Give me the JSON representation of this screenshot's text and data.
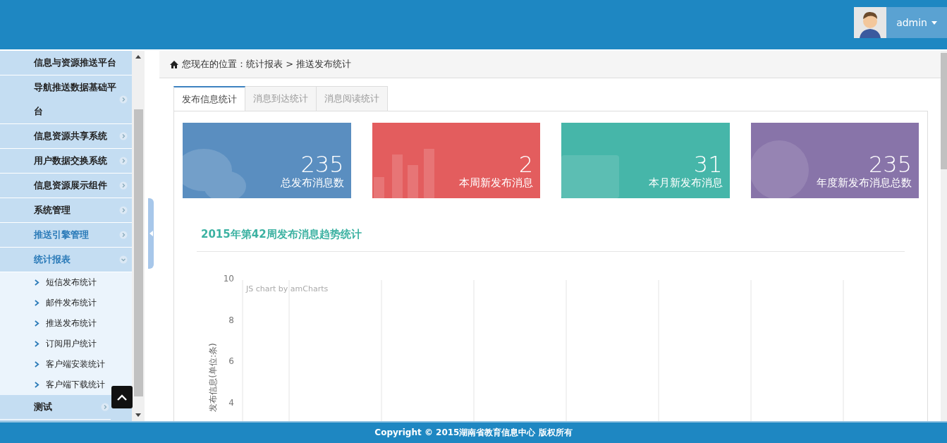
{
  "header": {
    "user": {
      "name": "admin"
    }
  },
  "sidebar": {
    "items": [
      {
        "label": "信息与资源推送平台",
        "active": false,
        "has_arrow": false
      },
      {
        "label": "导航推送数据基础平台",
        "active": false,
        "has_arrow": true
      },
      {
        "label": "信息资源共享系统",
        "active": false,
        "has_arrow": true
      },
      {
        "label": "用户数据交换系统",
        "active": false,
        "has_arrow": true
      },
      {
        "label": "信息资源展示组件",
        "active": false,
        "has_arrow": true
      },
      {
        "label": "系统管理",
        "active": false,
        "has_arrow": true
      },
      {
        "label": "推送引擎管理",
        "active": true,
        "has_arrow": true
      },
      {
        "label": "统计报表",
        "active": true,
        "has_arrow": true,
        "children": [
          {
            "label": "短信发布统计"
          },
          {
            "label": "邮件发布统计"
          },
          {
            "label": "推送发布统计"
          },
          {
            "label": "订阅用户统计"
          },
          {
            "label": "客户端安装统计"
          },
          {
            "label": "客户端下载统计"
          }
        ]
      },
      {
        "label": "测试",
        "active": false,
        "has_arrow": true
      }
    ]
  },
  "breadcrumb": "您现在的位置：统计报表 > 推送发布统计",
  "tabs": [
    {
      "label": "发布信息统计",
      "selected": true
    },
    {
      "label": "消息到达统计",
      "selected": false
    },
    {
      "label": "消息阅读统计",
      "selected": false
    }
  ],
  "cards": [
    {
      "value": "235",
      "label": "总发布消息数",
      "color": "#5a8ec0"
    },
    {
      "value": "2",
      "label": "本周新发布消息",
      "color": "#e35d5e"
    },
    {
      "value": "31",
      "label": "本月新发布消息",
      "color": "#46b6a9"
    },
    {
      "value": "235",
      "label": "年度新发布消息总数",
      "color": "#8874a9"
    }
  ],
  "chart_section": {
    "title": "2015年第42周发布消息趋势统计",
    "credit": "JS chart by amCharts",
    "y_axis": {
      "label": "发布信息(单位:条)",
      "ticks": [
        "10",
        "8",
        "6",
        "4"
      ]
    }
  },
  "footer": "Copyright © 2015湖南省教育信息中心 版权所有"
}
